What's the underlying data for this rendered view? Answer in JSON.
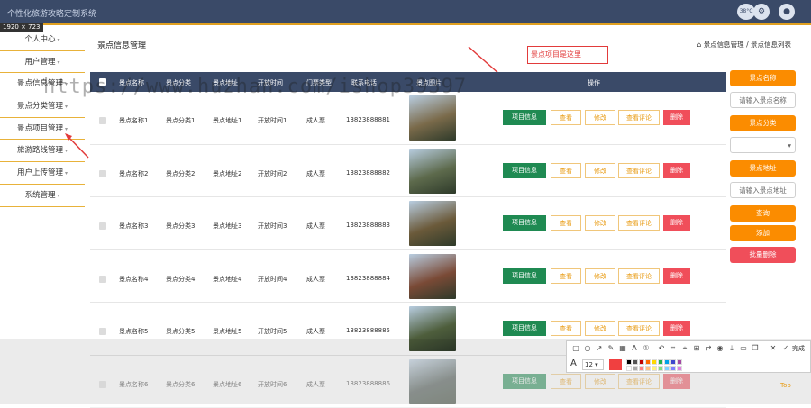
{
  "app_title": "个性化旅游攻略定制系统",
  "screen_dims": "1920 × 723",
  "header_icons": {
    "status_label": "38°C"
  },
  "sidebar": {
    "items": [
      {
        "label": "个人中心"
      },
      {
        "label": "用户管理"
      },
      {
        "label": "景点信息管理"
      },
      {
        "label": "景点分类管理"
      },
      {
        "label": "景点项目管理"
      },
      {
        "label": "旅游路线管理"
      },
      {
        "label": "用户上传管理"
      },
      {
        "label": "系统管理"
      }
    ]
  },
  "main": {
    "title": "景点信息管理"
  },
  "breadcrumb": {
    "home_icon": "home-icon",
    "parts": [
      "景点信息管理",
      "/",
      "景点信息列表"
    ]
  },
  "annotation": {
    "callout": "景点项目是这里"
  },
  "table": {
    "headers": [
      "景点名称",
      "景点分类",
      "景点地址",
      "开放时间",
      "门票类型",
      "联系电话",
      "景点图片",
      "操作"
    ],
    "actions": {
      "info": "项目信息",
      "view": "查看",
      "edit": "修改",
      "review": "查看评论",
      "delete": "删除"
    },
    "rows": [
      {
        "name": "景点名称1",
        "category": "景点分类1",
        "address": "景点地址1",
        "hours": "开放时间1",
        "ticket": "成人票",
        "phone": "13823888881",
        "img": "#7a6a4a"
      },
      {
        "name": "景点名称2",
        "category": "景点分类2",
        "address": "景点地址2",
        "hours": "开放时间2",
        "ticket": "成人票",
        "phone": "13823888882",
        "img": "#5d6a4c"
      },
      {
        "name": "景点名称3",
        "category": "景点分类3",
        "address": "景点地址3",
        "hours": "开放时间3",
        "ticket": "成人票",
        "phone": "13823888883",
        "img": "#6b5a3a"
      },
      {
        "name": "景点名称4",
        "category": "景点分类4",
        "address": "景点地址4",
        "hours": "开放时间4",
        "ticket": "成人票",
        "phone": "13823888884",
        "img": "#7a4a36"
      },
      {
        "name": "景点名称5",
        "category": "景点分类5",
        "address": "景点地址5",
        "hours": "开放时间5",
        "ticket": "成人票",
        "phone": "13823888885",
        "img": "#4e5e3c"
      },
      {
        "name": "景点名称6",
        "category": "景点分类6",
        "address": "景点地址6",
        "hours": "开放时间6",
        "ticket": "成人票",
        "phone": "13823888886",
        "img": "#3d4a44"
      }
    ]
  },
  "search_panel": {
    "name_label": "景点名称",
    "name_placeholder": "请输入景点名称",
    "category_label": "景点分类",
    "address_label": "景点地址",
    "address_placeholder": "请输入景点地址",
    "query": "查询",
    "add": "添加",
    "batch_delete": "批量删除"
  },
  "screenshot_toolbar": {
    "font_size": "12",
    "done": "完成"
  },
  "watermark": "https://www.huzhan.com/ishop39397",
  "top_link": "Top",
  "colors": {
    "header": "#3a4a68",
    "accent": "#fb8c00",
    "danger": "#f04e5a",
    "info": "#1f8a52"
  }
}
